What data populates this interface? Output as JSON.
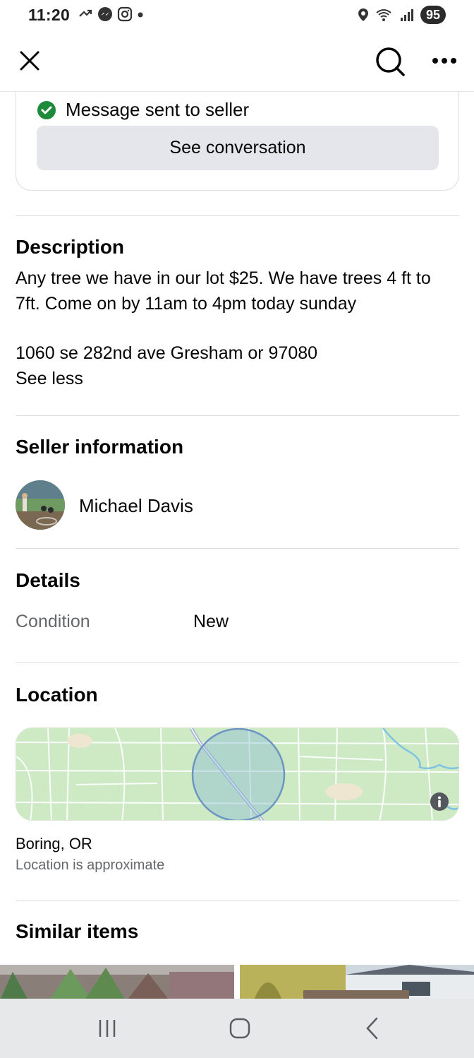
{
  "status_bar": {
    "time": "11:20",
    "battery": "95"
  },
  "app_bar": {
    "close_icon": "close-icon",
    "search_icon": "search-icon",
    "more_icon": "more-icon"
  },
  "message": {
    "status_text": "Message sent to seller",
    "see_conversation_label": "See conversation",
    "check_color": "#1f8b3a"
  },
  "description": {
    "title": "Description",
    "line1": "Any tree we have in our lot $25. We have trees 4 ft to",
    "line2": "7ft. Come on by 11am to 4pm today sunday",
    "address": "1060 se 282nd ave Gresham or 97080",
    "see_less": "See less"
  },
  "seller": {
    "title": "Seller information",
    "name": "Michael Davis"
  },
  "details": {
    "title": "Details",
    "condition_label": "Condition",
    "condition_value": "New"
  },
  "location": {
    "title": "Location",
    "city": "Boring, OR",
    "note": "Location is approximate"
  },
  "similar": {
    "title": "Similar items"
  },
  "system_nav": {
    "recents_icon": "recents-icon",
    "home_icon": "home-icon",
    "back_icon": "back-icon"
  }
}
